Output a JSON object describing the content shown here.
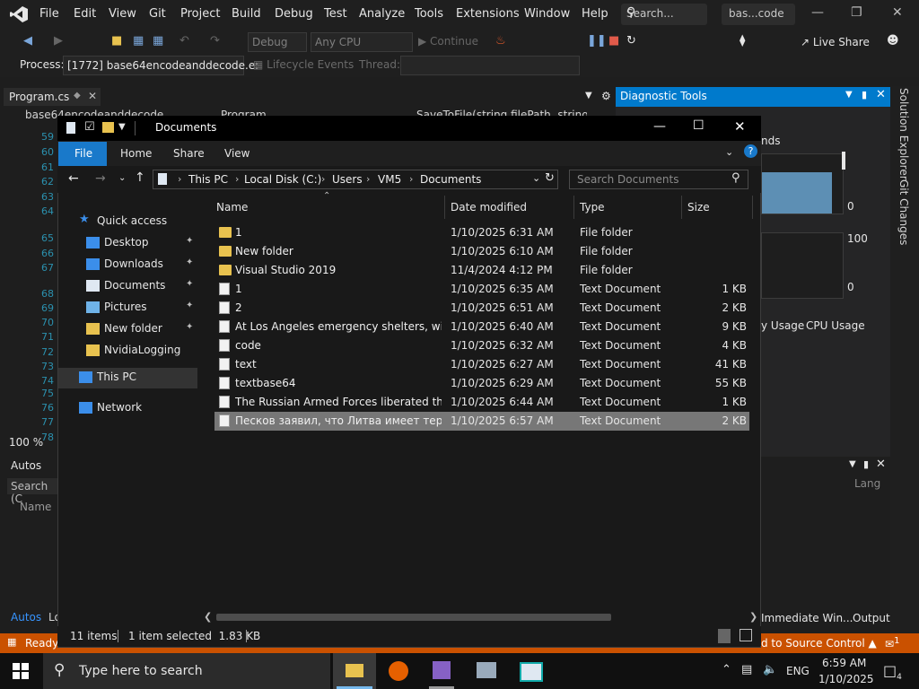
{
  "vs": {
    "menu": [
      "File",
      "Edit",
      "View",
      "Git",
      "Project",
      "Build",
      "Debug",
      "Test",
      "Analyze",
      "Tools",
      "Extensions",
      "Window",
      "Help"
    ],
    "search_placeholder": "Search...",
    "solution_name": "bas...code",
    "live_share": "Live Share",
    "debug_config": "Debug",
    "platform": "Any CPU",
    "continue_label": "Continue",
    "process_label": "Process:",
    "process_value": "[1772] base64encodeanddecode.e:",
    "lifecycle_label": "Lifecycle Events",
    "thread_label": "Thread:",
    "tab_program": "Program.cs",
    "file_tab": "base64encodeanddecode",
    "tab_program2": "Program",
    "tab_method": "SaveToFile(string filePath, string",
    "line_numbers": [
      "59",
      "60",
      "61",
      "62",
      "63",
      "64",
      "65",
      "66",
      "67",
      "68",
      "69",
      "70",
      "71",
      "72",
      "73",
      "74",
      "75",
      "76",
      "77",
      "78",
      "79"
    ],
    "zoom": "100 %",
    "autos_title": "Autos",
    "autos_search": "Search (C",
    "autos_col": "Name",
    "autos_tab": "Autos",
    "autos_tab2": "Lo",
    "diag_title": "Diagnostic Tools",
    "diag_seconds": "nds",
    "diag_zero1": "0",
    "diag_hundred": "100",
    "diag_zero2": "0",
    "diag_mem_usage": "y Usage",
    "diag_cpu_usage": "CPU Usage",
    "diag_lang": "Lang",
    "immediate_tab": "Immediate Win...",
    "output_tab": "Output",
    "solution_explorer": "Solution Explorer",
    "git_changes": "Git Changes",
    "status_ready": "Ready",
    "status_source_control": "d to Source Control",
    "status_notifications": "1"
  },
  "explorer": {
    "title": "Documents",
    "ribbon_tabs": [
      "File",
      "Home",
      "Share",
      "View"
    ],
    "breadcrumb": [
      "This PC",
      "Local Disk (C:)",
      "Users",
      "VM5",
      "Documents"
    ],
    "search_placeholder": "Search Documents",
    "nav": [
      {
        "label": "Quick access",
        "icon": "star-icon",
        "pinned": false
      },
      {
        "label": "Desktop",
        "icon": "desktop-icon",
        "pinned": true
      },
      {
        "label": "Downloads",
        "icon": "download-icon",
        "pinned": true
      },
      {
        "label": "Documents",
        "icon": "documents-icon",
        "pinned": true
      },
      {
        "label": "Pictures",
        "icon": "pictures-icon",
        "pinned": true
      },
      {
        "label": "New folder",
        "icon": "folder-icon",
        "pinned": true
      },
      {
        "label": "NvidiaLogging",
        "icon": "folder-icon",
        "pinned": false
      },
      {
        "label": "This PC",
        "icon": "computer-icon",
        "pinned": false
      },
      {
        "label": "Network",
        "icon": "network-icon",
        "pinned": false
      }
    ],
    "columns": [
      "Name",
      "Date modified",
      "Type",
      "Size"
    ],
    "files": [
      {
        "name": "1",
        "date": "1/10/2025 6:31 AM",
        "type": "File folder",
        "size": "",
        "kind": "folder"
      },
      {
        "name": "New folder",
        "date": "1/10/2025 6:10 AM",
        "type": "File folder",
        "size": "",
        "kind": "folder"
      },
      {
        "name": "Visual Studio 2019",
        "date": "11/4/2024 4:12 PM",
        "type": "File folder",
        "size": "",
        "kind": "folder"
      },
      {
        "name": "1",
        "date": "1/10/2025 6:35 AM",
        "type": "Text Document",
        "size": "1 KB",
        "kind": "doc"
      },
      {
        "name": "2",
        "date": "1/10/2025 6:51 AM",
        "type": "Text Document",
        "size": "2 KB",
        "kind": "doc"
      },
      {
        "name": "At Los Angeles emergency shelters, wildf...",
        "date": "1/10/2025 6:40 AM",
        "type": "Text Document",
        "size": "9 KB",
        "kind": "doc"
      },
      {
        "name": "code",
        "date": "1/10/2025 6:32 AM",
        "type": "Text Document",
        "size": "4 KB",
        "kind": "doc"
      },
      {
        "name": "text",
        "date": "1/10/2025 6:27 AM",
        "type": "Text Document",
        "size": "41 KB",
        "kind": "doc"
      },
      {
        "name": "textbase64",
        "date": "1/10/2025 6:29 AM",
        "type": "Text Document",
        "size": "55 KB",
        "kind": "doc"
      },
      {
        "name": "The Russian Armed Forces liberated three...",
        "date": "1/10/2025 6:44 AM",
        "type": "Text Document",
        "size": "1 KB",
        "kind": "doc"
      },
      {
        "name": "Песков заявил, что Литва имеет террит...",
        "date": "1/10/2025 6:57 AM",
        "type": "Text Document",
        "size": "2 KB",
        "kind": "doc",
        "selected": true
      }
    ],
    "status_items": "11 items",
    "status_selected": "1 item selected  1.83 KB"
  },
  "taskbar": {
    "search_placeholder": "Type here to search",
    "language": "ENG",
    "time": "6:59 AM",
    "date": "1/10/2025",
    "notification_count": "4"
  },
  "colors": {
    "vs_accent": "#007acc",
    "status_orange": "#ca5100",
    "ribbon_file": "#1979ca",
    "selection": "#777777",
    "folder": "#e8c24f"
  }
}
